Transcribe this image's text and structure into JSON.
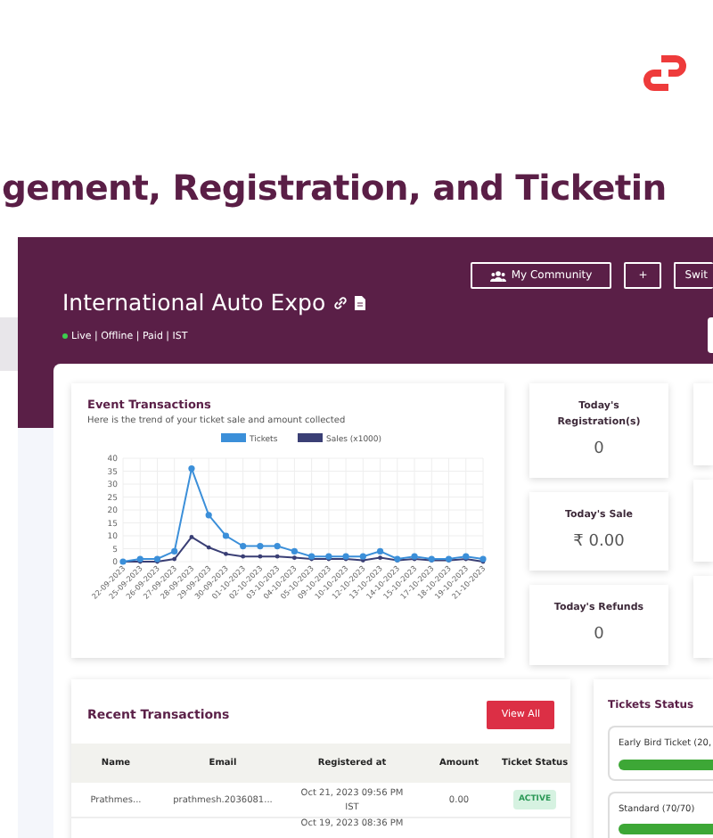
{
  "heading": "gement, Registration, and Ticketin",
  "event": {
    "title": "International Auto Expo",
    "meta": "Live | Offline | Paid | IST"
  },
  "header_buttons": [
    {
      "kind": "community",
      "label": "My Community"
    },
    {
      "kind": "plain",
      "label": "+"
    },
    {
      "kind": "plain",
      "label": "Swit"
    }
  ],
  "chart_card": {
    "title": "Event Transactions",
    "subtitle": "Here is the trend of your ticket sale and amount collected",
    "chart_data": {
      "type": "line",
      "categories": [
        "22-09-2023",
        "25-09-2023",
        "26-09-2023",
        "27-09-2023",
        "28-09-2023",
        "29-09-2023",
        "30-09-2023",
        "01-10-2023",
        "02-10-2023",
        "03-10-2023",
        "04-10-2023",
        "05-10-2023",
        "09-10-2023",
        "10-10-2023",
        "12-10-2023",
        "13-10-2023",
        "14-10-2023",
        "15-10-2023",
        "17-10-2023",
        "18-10-2023",
        "19-10-2023",
        "21-10-2023"
      ],
      "series": [
        {
          "name": "Tickets",
          "color": "#3b8fd9",
          "marker": true,
          "values": [
            0,
            1,
            1,
            4,
            36,
            18,
            10,
            6,
            6,
            6,
            4,
            2,
            2,
            2,
            2,
            4,
            1,
            2,
            1,
            1,
            2,
            1
          ]
        },
        {
          "name": "Sales (x1000)",
          "color": "#3a3f75",
          "marker": true,
          "values": [
            0,
            0,
            0,
            1,
            9.5,
            5.5,
            3,
            2,
            2,
            2,
            1.5,
            1,
            1,
            1,
            0.5,
            1.5,
            0.5,
            1,
            0.5,
            0.5,
            1,
            0
          ]
        }
      ],
      "grid": true,
      "legend": true,
      "ylim": [
        0,
        40
      ],
      "yticks": [
        0,
        5,
        10,
        15,
        20,
        25,
        30,
        35,
        40
      ]
    }
  },
  "stats": [
    {
      "label": "Today's Registration(s)",
      "value": "0"
    },
    {
      "label": "Today's Sale",
      "value": "₹ 0.00"
    },
    {
      "label": "Today's Refunds",
      "value": "0"
    }
  ],
  "recent": {
    "title": "Recent Transactions",
    "button": "View All",
    "columns": [
      "Name",
      "Email",
      "Registered at",
      "Amount",
      "Ticket Status"
    ],
    "rows": [
      {
        "name": "Prathmes...",
        "email": "prathmesh.2036081...",
        "registered": "Oct 21, 2023 09:56 PM IST",
        "amount": "0.00",
        "status": "ACTIVE"
      },
      {
        "registered": "Oct 19, 2023 08:36 PM"
      }
    ]
  },
  "tickets": {
    "title": "Tickets Status",
    "items": [
      {
        "label": "Early Bird Ticket (20,",
        "level": 1
      },
      {
        "label": "Standard (70/70)",
        "level": 1
      }
    ]
  }
}
